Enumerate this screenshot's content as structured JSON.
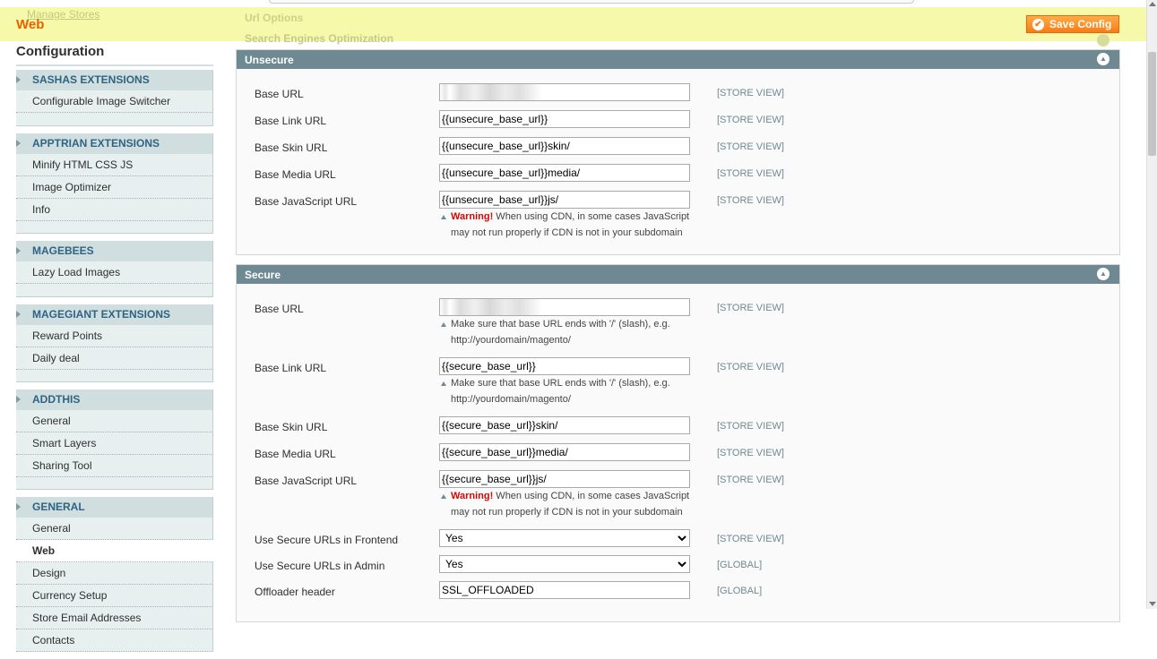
{
  "header": {
    "title": "Web",
    "save_label": "Save Config",
    "ghost_stores_link": "Manage Stores",
    "ghost_url_options": "Url Options",
    "ghost_seo": "Search Engines Optimization"
  },
  "sidebar": {
    "heading": "Configuration",
    "groups": [
      {
        "title": "SASHAS EXTENSIONS",
        "items": [
          "Configurable Image Switcher"
        ]
      },
      {
        "title": "APPTRIAN EXTENSIONS",
        "items": [
          "Minify HTML CSS JS",
          "Image Optimizer",
          "Info"
        ]
      },
      {
        "title": "MAGEBEES",
        "items": [
          "Lazy Load Images"
        ]
      },
      {
        "title": "MAGEGIANT EXTENSIONS",
        "items": [
          "Reward Points",
          "Daily deal"
        ]
      },
      {
        "title": "ADDTHIS",
        "items": [
          "General",
          "Smart Layers",
          "Sharing Tool"
        ]
      },
      {
        "title": "GENERAL",
        "items": [
          "General",
          "Web",
          "Design",
          "Currency Setup",
          "Store Email Addresses",
          "Contacts"
        ]
      }
    ]
  },
  "unsecure": {
    "title": "Unsecure",
    "rows": [
      {
        "label": "Base URL",
        "value": "",
        "scope": "[STORE VIEW]"
      },
      {
        "label": "Base Link URL",
        "value": "{{unsecure_base_url}}",
        "scope": "[STORE VIEW]"
      },
      {
        "label": "Base Skin URL",
        "value": "{{unsecure_base_url}}skin/",
        "scope": "[STORE VIEW]"
      },
      {
        "label": "Base Media URL",
        "value": "{{unsecure_base_url}}media/",
        "scope": "[STORE VIEW]"
      },
      {
        "label": "Base JavaScript URL",
        "value": "{{unsecure_base_url}}js/",
        "scope": "[STORE VIEW]"
      }
    ],
    "js_note": {
      "warn": "Warning!",
      "text": " When using CDN, in some cases JavaScript may not run properly if CDN is not in your subdomain"
    }
  },
  "secure": {
    "title": "Secure",
    "rows": [
      {
        "label": "Base URL",
        "value": "",
        "scope": "[STORE VIEW]"
      },
      {
        "label": "Base Link URL",
        "value": "{{secure_base_url}}",
        "scope": "[STORE VIEW]"
      },
      {
        "label": "Base Skin URL",
        "value": "{{secure_base_url}}skin/",
        "scope": "[STORE VIEW]"
      },
      {
        "label": "Base Media URL",
        "value": "{{secure_base_url}}media/",
        "scope": "[STORE VIEW]"
      },
      {
        "label": "Base JavaScript URL",
        "value": "{{secure_base_url}}js/",
        "scope": "[STORE VIEW]"
      },
      {
        "label": "Use Secure URLs in Frontend",
        "value": "Yes",
        "scope": "[STORE VIEW]"
      },
      {
        "label": "Use Secure URLs in Admin",
        "value": "Yes",
        "scope": "[GLOBAL]"
      },
      {
        "label": "Offloader header",
        "value": "SSL_OFFLOADED",
        "scope": "[GLOBAL]"
      }
    ],
    "slash_note": "Make sure that base URL ends with '/' (slash), e.g. http://yourdomain/magento/",
    "js_note": {
      "warn": "Warning!",
      "text": " When using CDN, in some cases JavaScript may not run properly if CDN is not in your subdomain"
    }
  }
}
